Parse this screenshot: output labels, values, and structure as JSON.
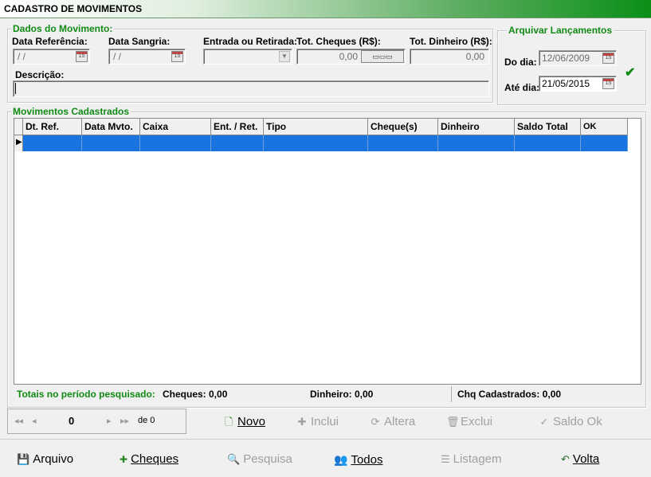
{
  "window": {
    "title": "CADASTRO DE MOVIMENTOS"
  },
  "dados": {
    "legend": "Dados do Movimento:",
    "data_ref_label": "Data Referência:",
    "data_ref_value": " /  /",
    "data_sangria_label": "Data Sangria:",
    "data_sangria_value": " /  /",
    "entrada_label": "Entrada ou Retirada:",
    "tot_cheques_label": "Tot. Cheques (R$):",
    "tot_cheques_value": "0,00",
    "tot_dinheiro_label": "Tot. Dinheiro (R$):",
    "tot_dinheiro_value": "0,00",
    "descricao_label": "Descrição:"
  },
  "arquivar": {
    "legend": "Arquivar Lançamentos",
    "do_dia_label": "Do dia:",
    "do_dia_value": "12/06/2009",
    "ate_dia_label": "Até dia:",
    "ate_dia_value": "21/05/2015",
    "cal_icon_text": "15"
  },
  "movimentos": {
    "legend": "Movimentos Cadastrados",
    "columns": [
      "Dt. Ref.",
      "Data Mvto.",
      "Caixa",
      "Ent. / Ret.",
      "Tipo",
      "Cheque(s)",
      "Dinheiro",
      "Saldo Total",
      "OK"
    ]
  },
  "totais": {
    "label": "Totais no período pesquisado:",
    "cheques": "Cheques:  0,00",
    "dinheiro": "Dinheiro:  0,00",
    "chq_cadastrados": "Chq Cadastrados:  0,00"
  },
  "nav": {
    "position": "0",
    "de": "de 0"
  },
  "actions": {
    "novo": "Novo",
    "inclui": "Inclui",
    "altera": "Altera",
    "exclui": "Exclui",
    "saldo_ok": "Saldo Ok"
  },
  "bottom": {
    "arquivo": "Arquivo",
    "cheques": "Cheques",
    "pesquisa": "Pesquisa",
    "todos": "Todos",
    "listagem": "Listagem",
    "volta": "Volta"
  },
  "colors": {
    "accent_green": "#118a14",
    "selection_blue": "#1874e0"
  }
}
